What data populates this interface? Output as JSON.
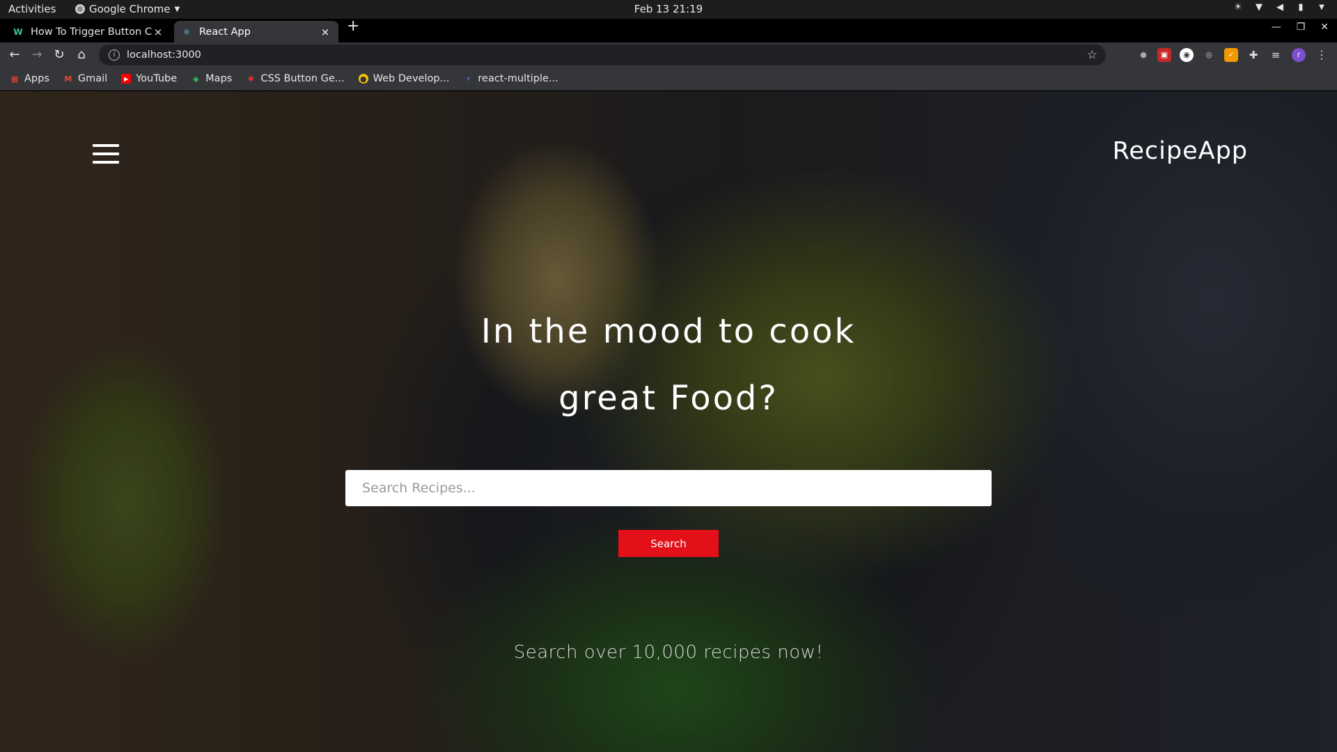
{
  "os": {
    "activities": "Activities",
    "app_name": "Google Chrome",
    "clock": "Feb 13  21:19"
  },
  "tabs": [
    {
      "title": "How To Trigger Button Cl",
      "close": "×"
    },
    {
      "title": "React App",
      "close": "×"
    }
  ],
  "new_tab": "+",
  "address": {
    "url": "localhost:3000"
  },
  "bookmarks": [
    {
      "label": "Apps",
      "icon": "apps-grid-icon",
      "color": "#ea4335"
    },
    {
      "label": "Gmail",
      "icon": "gmail-icon",
      "color": "#ea4335"
    },
    {
      "label": "YouTube",
      "icon": "youtube-icon",
      "color": "#ff0000"
    },
    {
      "label": "Maps",
      "icon": "maps-icon",
      "color": "#34a853"
    },
    {
      "label": "CSS Button Ge...",
      "icon": "css-button-icon",
      "color": "#e8322c"
    },
    {
      "label": "Web Develop...",
      "icon": "web-dev-icon",
      "color": "#f4c20d"
    },
    {
      "label": "react-multiple...",
      "icon": "bolt-icon",
      "color": "#4f7cff"
    }
  ],
  "app": {
    "brand": "RecipeApp",
    "headline_line1": "In the mood to cook",
    "headline_line2": "great Food?",
    "search_placeholder": "Search Recipes...",
    "search_button": "Search",
    "tagline": "Search over 10,000 recipes now!",
    "accent": "#e3101a"
  }
}
